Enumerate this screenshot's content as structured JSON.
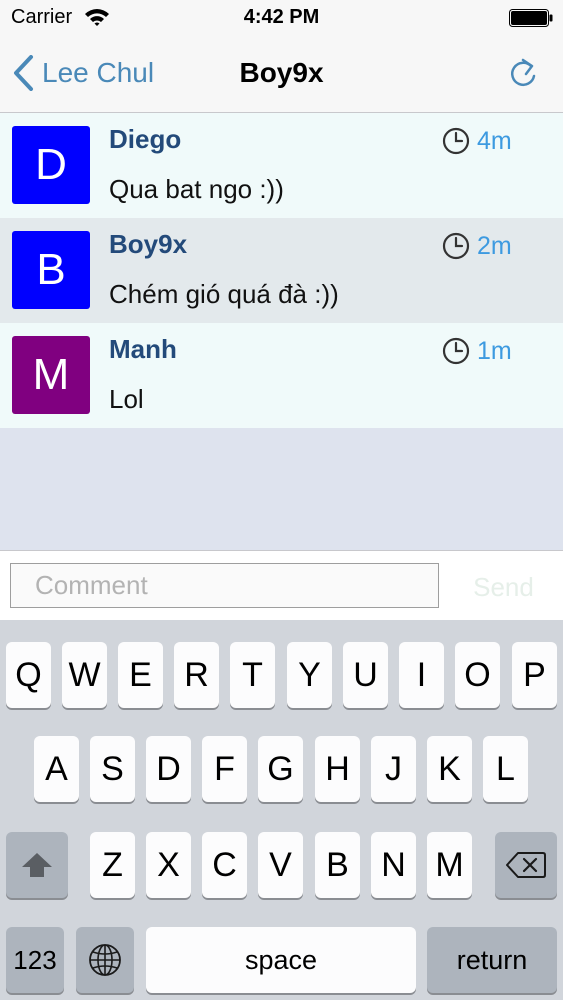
{
  "status_bar": {
    "carrier": "Carrier",
    "time": "4:42 PM"
  },
  "nav": {
    "back_label": "Lee Chul",
    "title": "Boy9x"
  },
  "messages": [
    {
      "initial": "D",
      "avatar_color": "#0000ff",
      "name": "Diego",
      "text": "Qua bat ngo :))",
      "time": "4m"
    },
    {
      "initial": "B",
      "avatar_color": "#0000ff",
      "name": "Boy9x",
      "text": "Chém gió quá đà :))",
      "time": "2m"
    },
    {
      "initial": "M",
      "avatar_color": "#800080",
      "name": "Manh",
      "text": "Lol",
      "time": "1m"
    }
  ],
  "composer": {
    "placeholder": "Comment",
    "send_label": "Send"
  },
  "keyboard": {
    "row1": [
      "Q",
      "W",
      "E",
      "R",
      "T",
      "Y",
      "U",
      "I",
      "O",
      "P"
    ],
    "row2": [
      "A",
      "S",
      "D",
      "F",
      "G",
      "H",
      "J",
      "K",
      "L"
    ],
    "row3": [
      "Z",
      "X",
      "C",
      "V",
      "B",
      "N",
      "M"
    ],
    "numbers_label": "123",
    "space_label": "space",
    "return_label": "return",
    "shift_icon": "shift-icon",
    "delete_icon": "delete-icon",
    "globe_icon": "globe-icon"
  },
  "colors": {
    "accent": "#4a89b8",
    "time_blue": "#3d9ae0",
    "name_blue": "#234a7a"
  }
}
